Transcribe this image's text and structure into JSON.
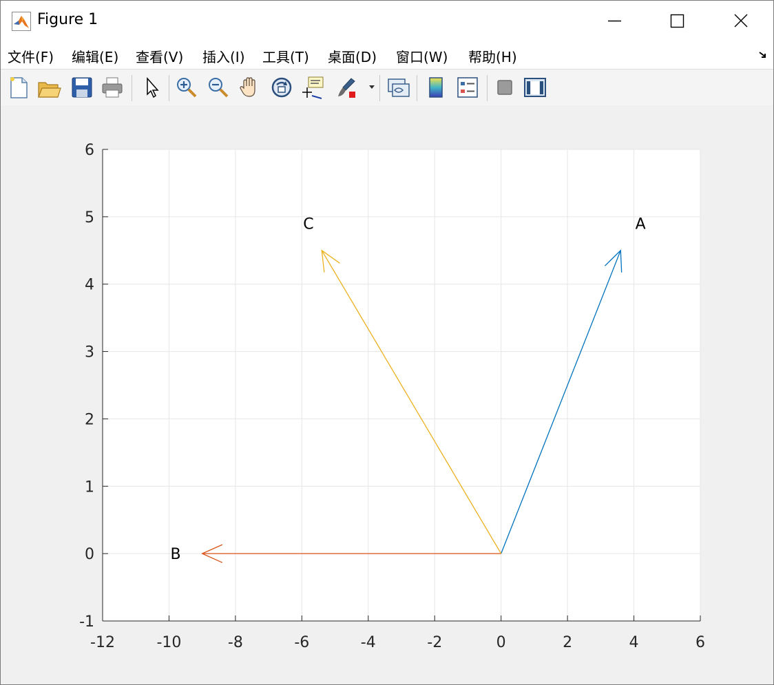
{
  "window": {
    "title": "Figure 1"
  },
  "menu": {
    "items": [
      {
        "label": "文件(F)"
      },
      {
        "label": "编辑(E)"
      },
      {
        "label": "查看(V)"
      },
      {
        "label": "插入(I)"
      },
      {
        "label": "工具(T)"
      },
      {
        "label": "桌面(D)"
      },
      {
        "label": "窗口(W)"
      },
      {
        "label": "帮助(H)"
      }
    ]
  },
  "toolbar": {
    "buttons": [
      {
        "icon": "new-figure-icon"
      },
      {
        "icon": "open-file-icon"
      },
      {
        "icon": "save-icon"
      },
      {
        "icon": "print-icon"
      },
      {
        "icon": "edit-plot-arrow-icon"
      },
      {
        "icon": "zoom-in-icon"
      },
      {
        "icon": "zoom-out-icon"
      },
      {
        "icon": "pan-hand-icon"
      },
      {
        "icon": "rotate-3d-icon"
      },
      {
        "icon": "data-cursor-icon"
      },
      {
        "icon": "brush-icon"
      },
      {
        "icon": "link-plot-icon"
      },
      {
        "icon": "colorbar-icon"
      },
      {
        "icon": "legend-icon"
      },
      {
        "icon": "hide-plot-tools-icon"
      },
      {
        "icon": "show-plot-tools-icon"
      }
    ]
  },
  "chart_data": {
    "type": "quiver",
    "xlim": [
      -12,
      6
    ],
    "ylim": [
      -1,
      6
    ],
    "xticks": [
      "-12",
      "-10",
      "-8",
      "-6",
      "-4",
      "-2",
      "0",
      "2",
      "4",
      "6"
    ],
    "yticks": [
      "-1",
      "0",
      "1",
      "2",
      "3",
      "4",
      "5",
      "6"
    ],
    "grid": true,
    "vectors": [
      {
        "name": "A",
        "x0": 0,
        "y0": 0,
        "x1": 3.6,
        "y1": 4.5,
        "color": "#0072BD",
        "label_x": 4.2,
        "label_y": 4.9
      },
      {
        "name": "B",
        "x0": 0,
        "y0": 0,
        "x1": -9,
        "y1": 0,
        "color": "#D95319",
        "label_x": -9.8,
        "label_y": 0
      },
      {
        "name": "C",
        "x0": 0,
        "y0": 0,
        "x1": -5.4,
        "y1": 4.5,
        "color": "#EDB120",
        "label_x": -5.8,
        "label_y": 4.9
      }
    ]
  }
}
